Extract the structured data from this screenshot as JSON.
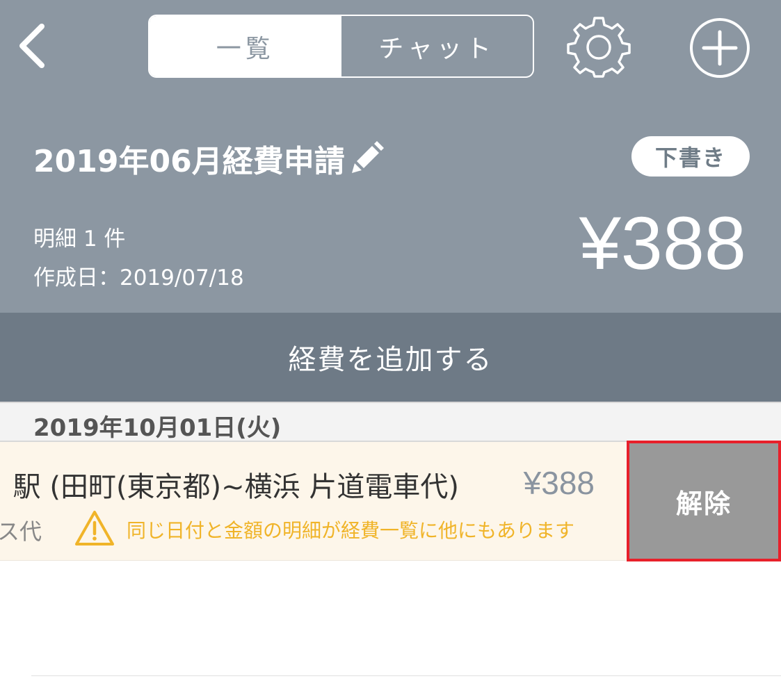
{
  "nav": {
    "tabs": [
      {
        "label": "一覧",
        "active": true
      },
      {
        "label": "チャット",
        "active": false
      }
    ]
  },
  "report": {
    "title": "2019年06月経費申請",
    "status": "下書き",
    "item_count_label": "明細 1 件",
    "created_label": "作成日：2019/07/18",
    "total": "¥388"
  },
  "actions": {
    "add_expense_label": "経費を追加する",
    "unlink_label": "解除"
  },
  "expenses": {
    "date_header": "2019年10月01日(火)",
    "items": [
      {
        "title": "駅 (田町(東京都)~横浜 片道電車代)",
        "amount": "¥388",
        "category": "交通費・バス代",
        "warning": "同じ日付と金額の明細が経費一覧に他にもあります"
      }
    ]
  },
  "colors": {
    "header_bg": "#8c97a2",
    "add_bar_bg": "#6e7a86",
    "row_highlight_bg": "#fdf6ea",
    "warning": "#f0b429",
    "unlink_bg": "#999999",
    "selection_outline": "#e8202a"
  },
  "icons": {
    "back": "chevron-left-icon",
    "settings": "gear-icon",
    "add": "plus-circle-icon",
    "edit": "pencil-icon",
    "warning": "warning-triangle-icon"
  }
}
